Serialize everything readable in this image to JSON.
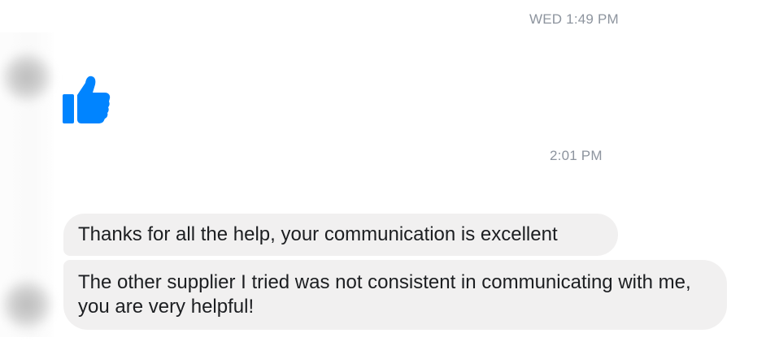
{
  "timestamps": {
    "first": "WED 1:49 PM",
    "second": "2:01 PM"
  },
  "messages": [
    {
      "text": "Thanks for all the help, your communication is excellent"
    },
    {
      "text": "The other supplier I tried was not consistent in communicating with me, you are very helpful!"
    }
  ],
  "icons": {
    "reaction": "thumbs-up-icon",
    "sender_avatar": "avatar"
  },
  "colors": {
    "like_blue": "#0084ff",
    "bubble_bg": "#f1f0f0",
    "timestamp": "#8d949e",
    "text": "#1c1e21"
  }
}
